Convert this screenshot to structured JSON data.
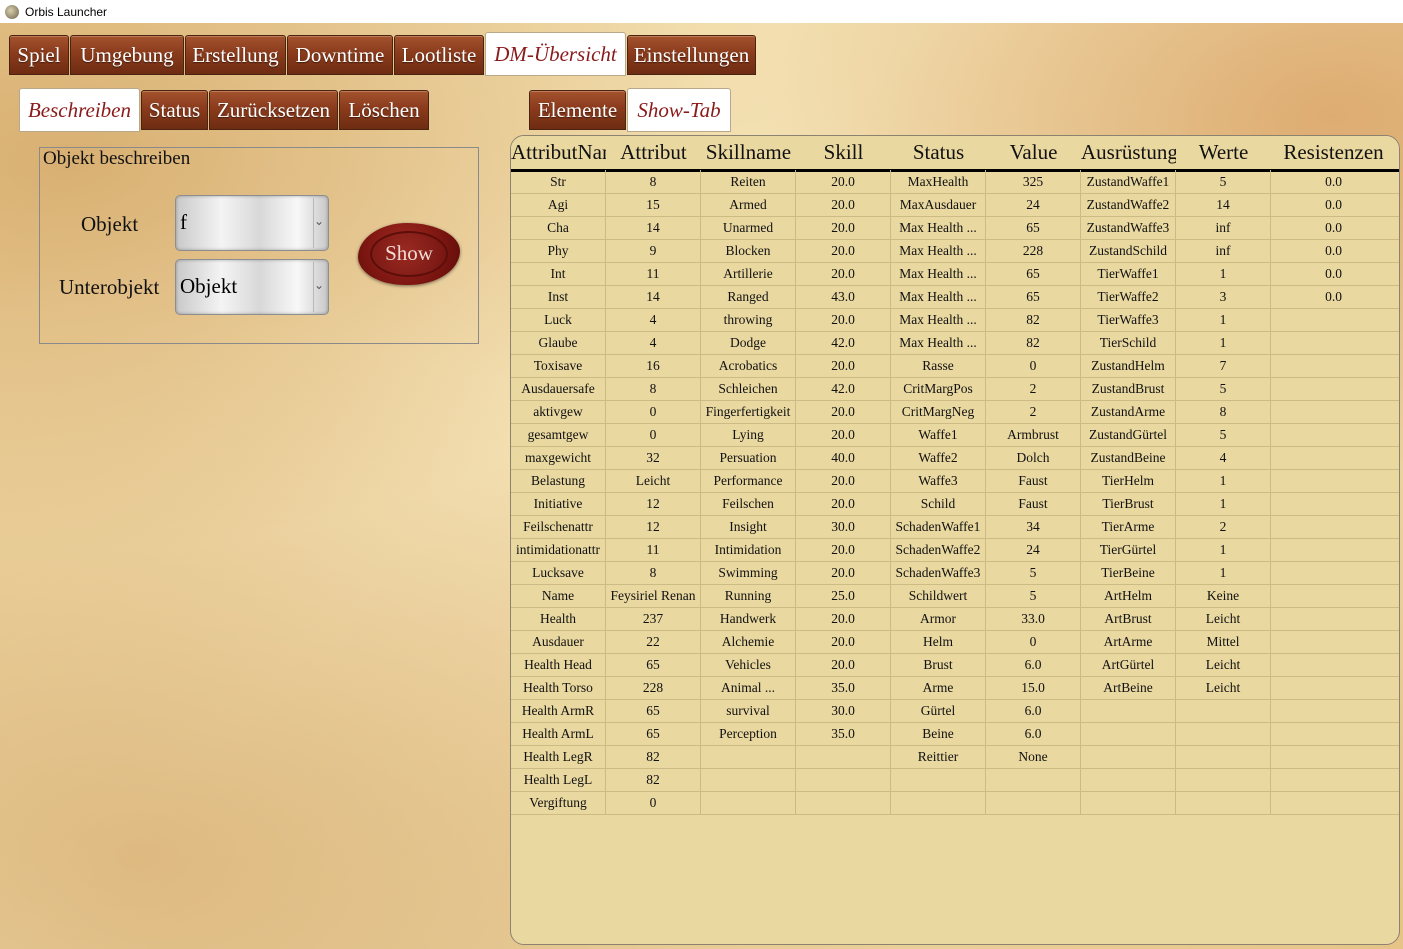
{
  "window": {
    "title": "Orbis Launcher",
    "icon": "app-icon"
  },
  "main_tabs": [
    {
      "label": "Spiel",
      "active": false
    },
    {
      "label": "Umgebung",
      "active": false
    },
    {
      "label": "Erstellung",
      "active": false
    },
    {
      "label": "Downtime",
      "active": false
    },
    {
      "label": "Lootliste",
      "active": false
    },
    {
      "label": "DM-Übersicht",
      "active": true
    },
    {
      "label": "Einstellungen",
      "active": false
    }
  ],
  "left_tabs": [
    {
      "label": "Beschreiben",
      "active": true
    },
    {
      "label": "Status",
      "active": false
    },
    {
      "label": "Zurücksetzen",
      "active": false
    },
    {
      "label": "Löschen",
      "active": false
    }
  ],
  "right_tabs": [
    {
      "label": "Elemente",
      "active": false
    },
    {
      "label": "Show-Tab",
      "active": true
    }
  ],
  "describe_panel": {
    "title": "Objekt beschreiben",
    "objekt_label": "Objekt",
    "objekt_value": "f",
    "unterobjekt_label": "Unterobjekt",
    "unterobjekt_value": "Objekt",
    "show_button": "Show"
  },
  "colors": {
    "tab_wood": "#8a3b1c",
    "active_tab_text": "#8b1a1a",
    "table_bg": "#e9d8a0",
    "wax": "#7a1510"
  },
  "table": {
    "headers": [
      "AttributNam",
      "Attribut",
      "Skillname",
      "Skill",
      "Status",
      "Value",
      "Ausrüstung",
      "Werte",
      "Resistenzen"
    ],
    "rows": [
      [
        "Str",
        "8",
        "Reiten",
        "20.0",
        "MaxHealth",
        "325",
        "ZustandWaffe1",
        "5",
        "0.0"
      ],
      [
        "Agi",
        "15",
        "Armed",
        "20.0",
        "MaxAusdauer",
        "24",
        "ZustandWaffe2",
        "14",
        "0.0"
      ],
      [
        "Cha",
        "14",
        "Unarmed",
        "20.0",
        "Max Health ...",
        "65",
        "ZustandWaffe3",
        "inf",
        "0.0"
      ],
      [
        "Phy",
        "9",
        "Blocken",
        "20.0",
        "Max Health ...",
        "228",
        "ZustandSchild",
        "inf",
        "0.0"
      ],
      [
        "Int",
        "11",
        "Artillerie",
        "20.0",
        "Max Health ...",
        "65",
        "TierWaffe1",
        "1",
        "0.0"
      ],
      [
        "Inst",
        "14",
        "Ranged",
        "43.0",
        "Max Health ...",
        "65",
        "TierWaffe2",
        "3",
        "0.0"
      ],
      [
        "Luck",
        "4",
        "throwing",
        "20.0",
        "Max Health ...",
        "82",
        "TierWaffe3",
        "1",
        ""
      ],
      [
        "Glaube",
        "4",
        "Dodge",
        "42.0",
        "Max Health ...",
        "82",
        "TierSchild",
        "1",
        ""
      ],
      [
        "Toxisave",
        "16",
        "Acrobatics",
        "20.0",
        "Rasse",
        "0",
        "ZustandHelm",
        "7",
        ""
      ],
      [
        "Ausdauersafe",
        "8",
        "Schleichen",
        "42.0",
        "CritMargPos",
        "2",
        "ZustandBrust",
        "5",
        ""
      ],
      [
        "aktivgew",
        "0",
        "Fingerfertigkeit",
        "20.0",
        "CritMargNeg",
        "2",
        "ZustandArme",
        "8",
        ""
      ],
      [
        "gesamtgew",
        "0",
        "Lying",
        "20.0",
        "Waffe1",
        "Armbrust",
        "ZustandGürtel",
        "5",
        ""
      ],
      [
        "maxgewicht",
        "32",
        "Persuation",
        "40.0",
        "Waffe2",
        "Dolch",
        "ZustandBeine",
        "4",
        ""
      ],
      [
        "Belastung",
        "Leicht",
        "Performance",
        "20.0",
        "Waffe3",
        "Faust",
        "TierHelm",
        "1",
        ""
      ],
      [
        "Initiative",
        "12",
        "Feilschen",
        "20.0",
        "Schild",
        "Faust",
        "TierBrust",
        "1",
        ""
      ],
      [
        "Feilschenattr",
        "12",
        "Insight",
        "30.0",
        "SchadenWaffe1",
        "34",
        "TierArme",
        "2",
        ""
      ],
      [
        "intimidationattr",
        "11",
        "Intimidation",
        "20.0",
        "SchadenWaffe2",
        "24",
        "TierGürtel",
        "1",
        ""
      ],
      [
        "Lucksave",
        "8",
        "Swimming",
        "20.0",
        "SchadenWaffe3",
        "5",
        "TierBeine",
        "1",
        ""
      ],
      [
        "Name",
        "Feysiriel Renan",
        "Running",
        "25.0",
        "Schildwert",
        "5",
        "ArtHelm",
        "Keine",
        ""
      ],
      [
        "Health",
        "237",
        "Handwerk",
        "20.0",
        "Armor",
        "33.0",
        "ArtBrust",
        "Leicht",
        ""
      ],
      [
        "Ausdauer",
        "22",
        "Alchemie",
        "20.0",
        "Helm",
        "0",
        "ArtArme",
        "Mittel",
        ""
      ],
      [
        "Health Head",
        "65",
        "Vehicles",
        "20.0",
        "Brust",
        "6.0",
        "ArtGürtel",
        "Leicht",
        ""
      ],
      [
        "Health Torso",
        "228",
        "Animal ...",
        "35.0",
        "Arme",
        "15.0",
        "ArtBeine",
        "Leicht",
        ""
      ],
      [
        "Health ArmR",
        "65",
        "survival",
        "30.0",
        "Gürtel",
        "6.0",
        "",
        "",
        ""
      ],
      [
        "Health ArmL",
        "65",
        "Perception",
        "35.0",
        "Beine",
        "6.0",
        "",
        "",
        ""
      ],
      [
        "Health LegR",
        "82",
        "",
        "",
        "Reittier",
        "None",
        "",
        "",
        ""
      ],
      [
        "Health LegL",
        "82",
        "",
        "",
        "",
        "",
        "",
        "",
        ""
      ],
      [
        "Vergiftung",
        "0",
        "",
        "",
        "",
        "",
        "",
        "",
        ""
      ]
    ]
  }
}
